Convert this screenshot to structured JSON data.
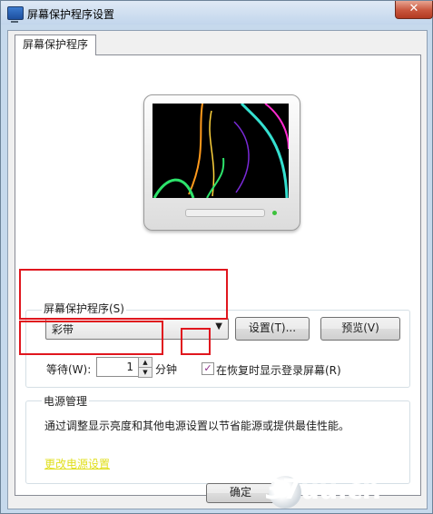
{
  "window": {
    "title": "屏幕保护程序设置",
    "close_glyph": "✕"
  },
  "tab": {
    "label": "屏幕保护程序"
  },
  "screensaver": {
    "group_label": "屏幕保护程序(S)",
    "selected": "彩带",
    "settings_button": "设置(T)...",
    "preview_button": "预览(V)"
  },
  "wait": {
    "label": "等待(W):",
    "value": "1",
    "unit": "分钟",
    "up_glyph": "▲",
    "down_glyph": "▼"
  },
  "resume": {
    "label": "在恢复时显示登录屏幕(R)",
    "checked": true,
    "check_glyph": "✓"
  },
  "power": {
    "group_label": "电源管理",
    "description": "通过调整显示亮度和其他电源设置以节省能源或提供最佳性能。",
    "link": "更改电源设置"
  },
  "footer": {
    "ok_button": "确定"
  },
  "watermark": {
    "text": "37uu.cn"
  },
  "colors": {
    "highlight": "#e0161e",
    "link": "#e0df1c",
    "ribbon_green": "#2de36b",
    "ribbon_cyan": "#35e0d0",
    "ribbon_magenta": "#ff2ad0",
    "ribbon_orange": "#ff9a1c"
  }
}
